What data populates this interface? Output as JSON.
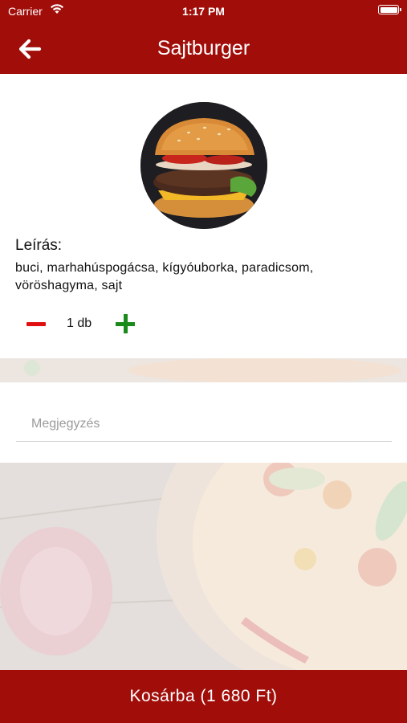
{
  "status_bar": {
    "carrier": "Carrier",
    "time": "1:17 PM"
  },
  "header": {
    "title": "Sajtburger",
    "back_icon": "arrow-left-icon"
  },
  "product": {
    "image_icon": "burger-image",
    "description_title": "Leírás:",
    "description": "buci, marhahúspogácsa, kígyóuborka, paradicsom, vöröshagyma, sajt",
    "quantity_text": "1 db"
  },
  "note": {
    "placeholder": "Megjegyzés",
    "value": ""
  },
  "cart": {
    "button_label": "Kosárba (1 680 Ft)"
  },
  "colors": {
    "brand": "#a10e0a",
    "minus": "#e01010",
    "plus": "#1a8a1a"
  }
}
